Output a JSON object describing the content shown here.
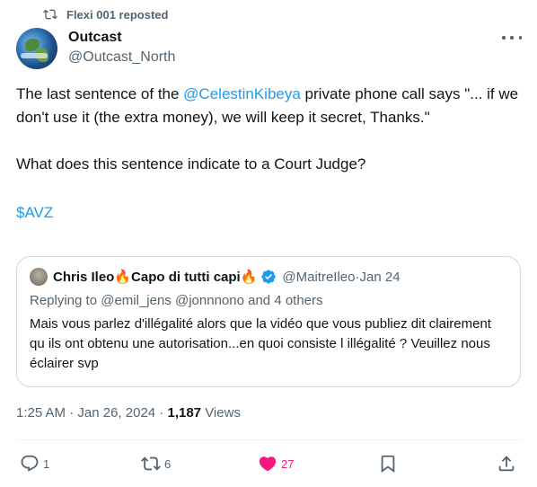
{
  "repost_banner": {
    "text": "Flexi 001 reposted"
  },
  "author": {
    "name": "Outcast",
    "handle": "@Outcast_North"
  },
  "tweet": {
    "line1_pre": "The last sentence of the ",
    "mention": "@CelestinKibeya",
    "line1_post": " private phone call says \"... if we don't use it (the extra money), we will keep it secret, Thanks.\"",
    "paragraph2": "What does this sentence indicate to a Court Judge?",
    "cashtag": "$AVZ"
  },
  "quoted": {
    "name_part1": "Chris Ileo",
    "name_fire1": "🔥",
    "name_part2": "Capo di tutti capi",
    "name_fire2": "🔥",
    "handle": "@MaitreIleo",
    "separator": " · ",
    "date": "Jan 24",
    "replying_prefix": "Replying to ",
    "reply_handle1": "@emil_jens",
    "reply_handle2": "@jonnnono",
    "reply_suffix": " and 4 others",
    "text": "Mais vous parlez d'illégalité alors que la vidéo que vous publiez dit clairement qu ils ont obtenu une autorisation...en quoi consiste l illégalité ? Veuillez nous éclairer svp"
  },
  "meta": {
    "time": "1:25 AM",
    "separator": " · ",
    "date": "Jan 26, 2024",
    "separator2": " · ",
    "views_count": "1,187",
    "views_label": " Views"
  },
  "actions": {
    "replies": "1",
    "reposts": "6",
    "likes": "27"
  },
  "colors": {
    "link": "#1d9bf0",
    "secondary_text": "#536471",
    "like_active": "#f91880",
    "verified": "#1d9bf0"
  },
  "icons": [
    "repost-icon",
    "more-icon",
    "verified-icon",
    "reply-icon",
    "heart-icon",
    "bookmark-icon",
    "share-icon"
  ]
}
